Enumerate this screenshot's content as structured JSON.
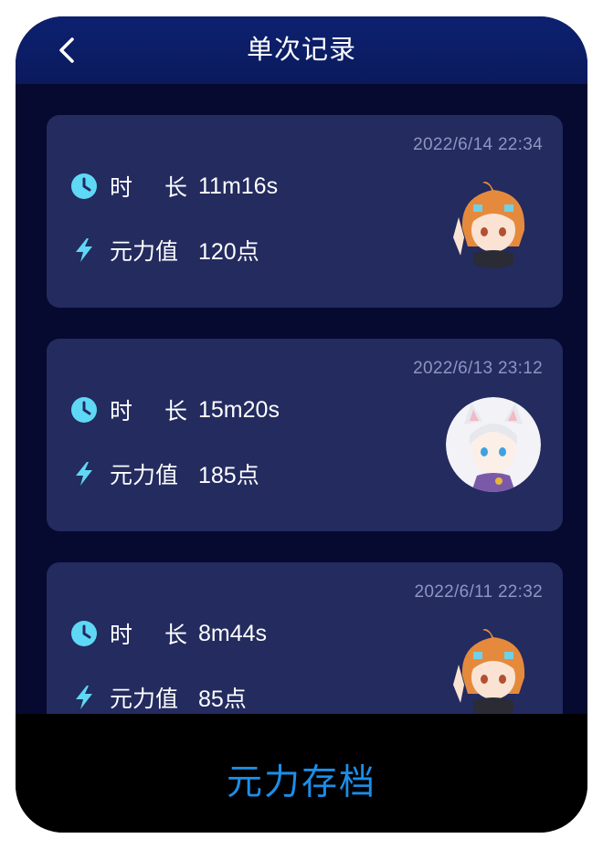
{
  "header": {
    "title": "单次记录"
  },
  "records": [
    {
      "date": "2022/6/14 22:34",
      "duration_label_1": "时",
      "duration_label_2": "长",
      "duration_value": "11m16s",
      "energy_label": "元力值",
      "energy_value": "120点",
      "avatar": "orange-hair-character"
    },
    {
      "date": "2022/6/13 23:12",
      "duration_label_1": "时",
      "duration_label_2": "长",
      "duration_value": "15m20s",
      "energy_label": "元力值",
      "energy_value": "185点",
      "avatar": "white-hair-character"
    },
    {
      "date": "2022/6/11 22:32",
      "duration_label_1": "时",
      "duration_label_2": "长",
      "duration_value": "8m44s",
      "energy_label": "元力值",
      "energy_value": "85点",
      "avatar": "orange-hair-character"
    }
  ],
  "footer": {
    "button_label": "元力存档"
  },
  "colors": {
    "accent": "#1c8ee8",
    "icon": "#5fd8f5",
    "card": "#232b5f",
    "background": "#060a30"
  },
  "icons": {
    "back": "chevron-left-icon",
    "duration": "clock-icon",
    "energy": "lightning-icon"
  }
}
